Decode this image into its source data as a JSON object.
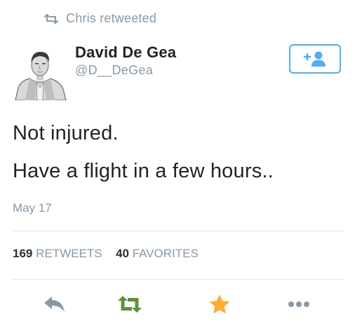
{
  "retweet_context": {
    "icon": "retweet-icon",
    "text": "Chris retweeted"
  },
  "author": {
    "name": "David De Gea",
    "handle": "@D__DeGea",
    "avatar": "avatar-photo"
  },
  "follow_button": {
    "icon": "follow-user-plus-icon",
    "color": "#55acee"
  },
  "tweet": {
    "lines": [
      "Not injured.",
      "Have a flight in a few hours.."
    ],
    "date": "May 17"
  },
  "stats": {
    "retweets_count": "169",
    "retweets_label": "RETWEETS",
    "favorites_count": "40",
    "favorites_label": "FAVORITES"
  },
  "actions": {
    "reply": {
      "icon": "reply-icon",
      "color": "#8899a6"
    },
    "retweet": {
      "icon": "retweet-icon",
      "color": "#5c913b"
    },
    "favorite": {
      "icon": "star-icon",
      "color": "#ffac33"
    },
    "more": {
      "icon": "more-dots-icon",
      "color": "#8899a6"
    }
  }
}
